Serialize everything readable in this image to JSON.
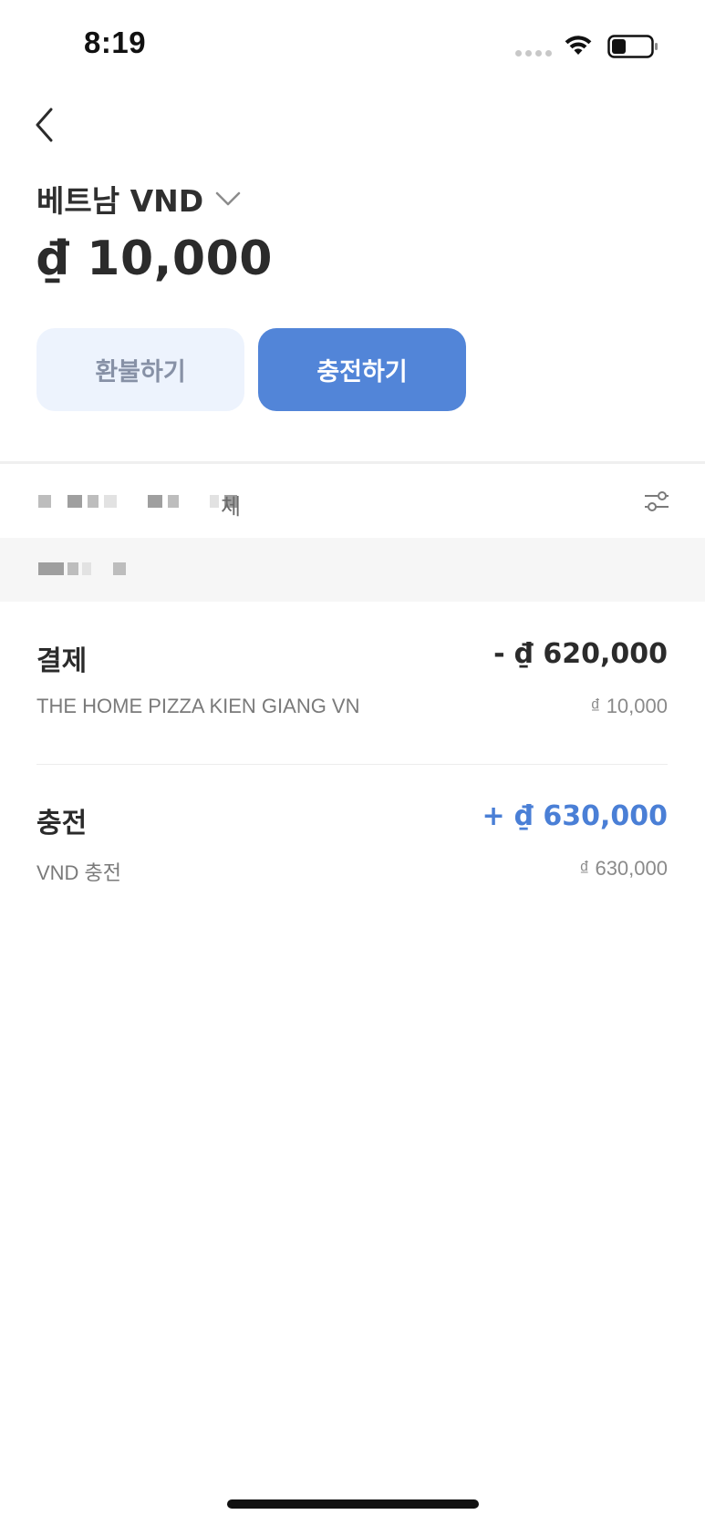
{
  "status_bar": {
    "time": "8:19",
    "wifi_icon": "wifi-icon",
    "battery_icon": "battery-icon",
    "battery_level": 0.35
  },
  "header": {
    "back_icon": "chevron-left-icon",
    "currency_name": "베트남 VND",
    "dropdown_icon": "chevron-down-icon",
    "balance": "₫ 10,000"
  },
  "actions": {
    "refund_label": "환불하기",
    "charge_label": "충전하기"
  },
  "filter": {
    "visible_text": "체",
    "settings_icon": "sliders-icon"
  },
  "transactions": [
    {
      "type": "결제",
      "amount": "- ₫ 620,000",
      "merchant": "THE HOME PIZZA KIEN GIANG VN",
      "balance_after": "₫ 10,000",
      "direction": "debit"
    },
    {
      "type": "충전",
      "amount": "+ ₫ 630,000",
      "merchant": "VND 충전",
      "balance_after": "₫ 630,000",
      "direction": "credit"
    }
  ],
  "colors": {
    "accent": "#5285d8",
    "credit_text": "#4a7fd6",
    "refund_bg": "#edf3fd",
    "refund_text": "#8791a6"
  }
}
